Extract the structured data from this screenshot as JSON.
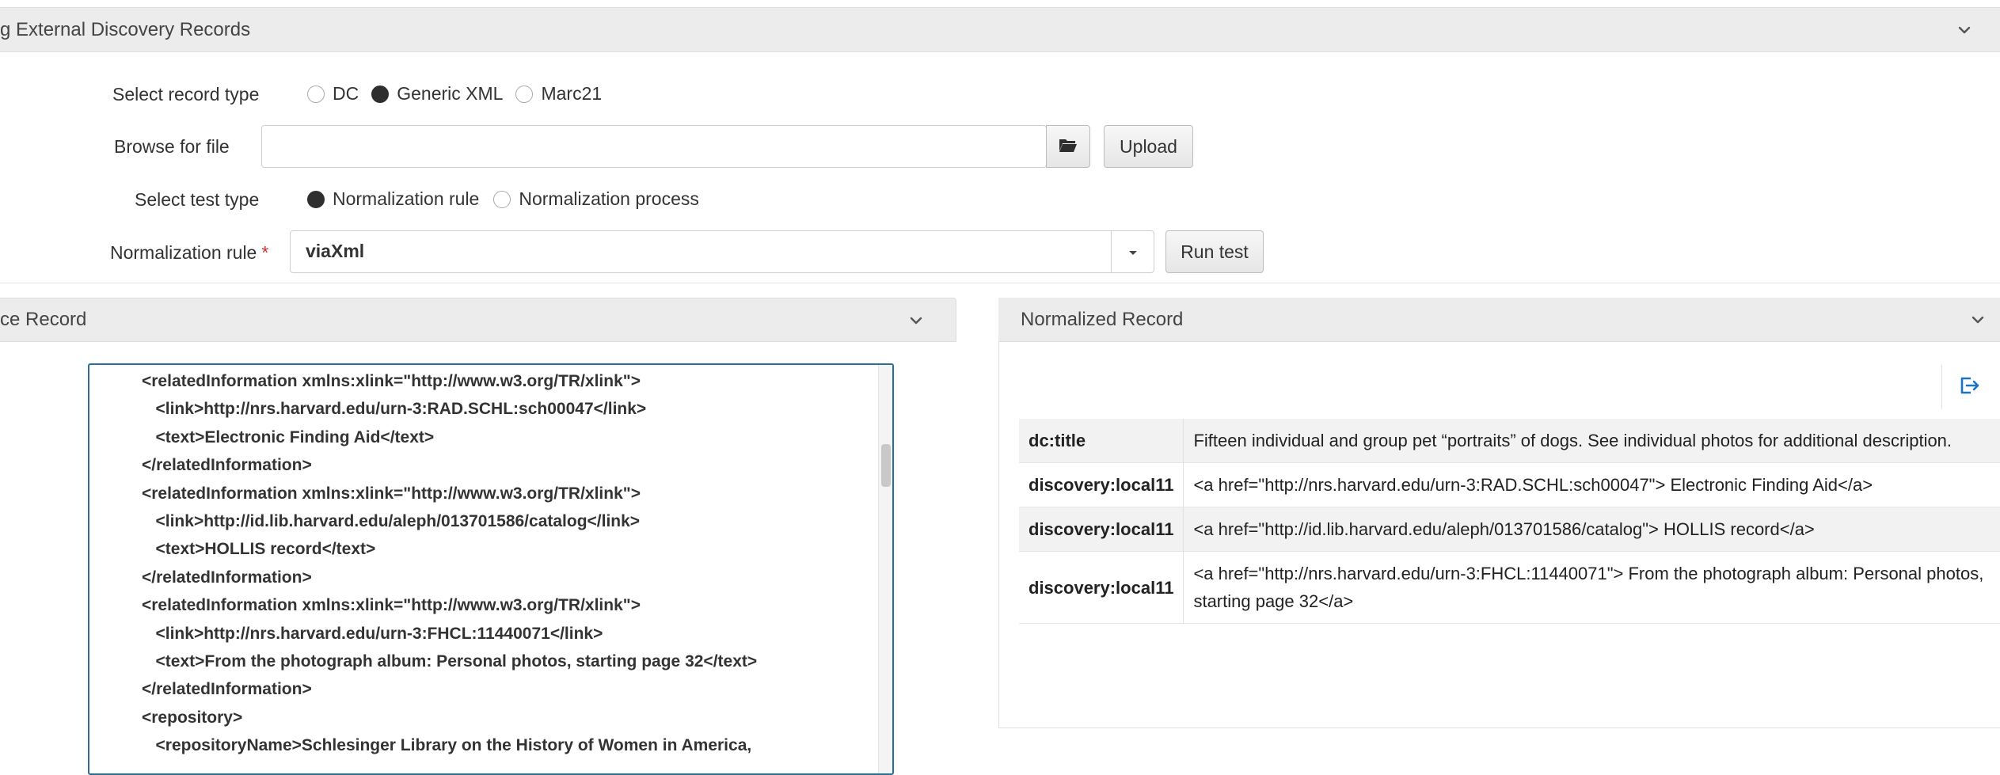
{
  "top_panel": {
    "title": "g External Discovery Records"
  },
  "form": {
    "record_type_label": "Select record type",
    "record_types": [
      {
        "label": "DC",
        "selected": false
      },
      {
        "label": "Generic XML",
        "selected": true
      },
      {
        "label": "Marc21",
        "selected": false
      }
    ],
    "browse_label": "Browse for file",
    "browse_value": "",
    "upload_label": "Upload",
    "test_type_label": "Select test type",
    "test_types": [
      {
        "label": "Normalization rule",
        "selected": true
      },
      {
        "label": "Normalization process",
        "selected": false
      }
    ],
    "rule_label": "Normalization rule",
    "rule_required_mark": "*",
    "rule_value": "viaXml",
    "run_test_label": "Run test"
  },
  "source_panel": {
    "title": "ce Record",
    "xml_lines": [
      "<relatedInformation xmlns:xlink=\"http://www.w3.org/TR/xlink\">",
      "   <link>http://nrs.harvard.edu/urn-3:RAD.SCHL:sch00047</link>",
      "   <text>Electronic Finding Aid</text>",
      "</relatedInformation>",
      "<relatedInformation xmlns:xlink=\"http://www.w3.org/TR/xlink\">",
      "   <link>http://id.lib.harvard.edu/aleph/013701586/catalog</link>",
      "   <text>HOLLIS record</text>",
      "</relatedInformation>",
      "<relatedInformation xmlns:xlink=\"http://www.w3.org/TR/xlink\">",
      "   <link>http://nrs.harvard.edu/urn-3:FHCL:11440071</link>",
      "   <text>From the photograph album: Personal photos, starting page 32</text>",
      "</relatedInformation>",
      "<repository>",
      "   <repositoryName>Schlesinger Library on the History of Women in America,"
    ]
  },
  "normalized_panel": {
    "title": "Normalized Record",
    "rows": [
      {
        "key": "dc:title",
        "value": "Fifteen individual and group pet “portraits” of dogs. See individual photos for additional description."
      },
      {
        "key": "discovery:local11",
        "value": "<a href=\"http://nrs.harvard.edu/urn-3:RAD.SCHL:sch00047\"> Electronic Finding Aid</a>"
      },
      {
        "key": "discovery:local11",
        "value": "<a href=\"http://id.lib.harvard.edu/aleph/013701586/catalog\"> HOLLIS record</a>"
      },
      {
        "key": "discovery:local11",
        "value": "<a href=\"http://nrs.harvard.edu/urn-3:FHCL:11440071\"> From the photograph album: Personal photos, starting page 32</a>"
      }
    ]
  },
  "colors": {
    "accent": "#1a73c8",
    "xml_border": "#2a6f97",
    "required": "#d32f2f"
  },
  "icons": {
    "collapse": "chevron-down-icon",
    "browse": "folder-icon",
    "dropdown": "caret-down-icon",
    "export": "export-icon"
  }
}
